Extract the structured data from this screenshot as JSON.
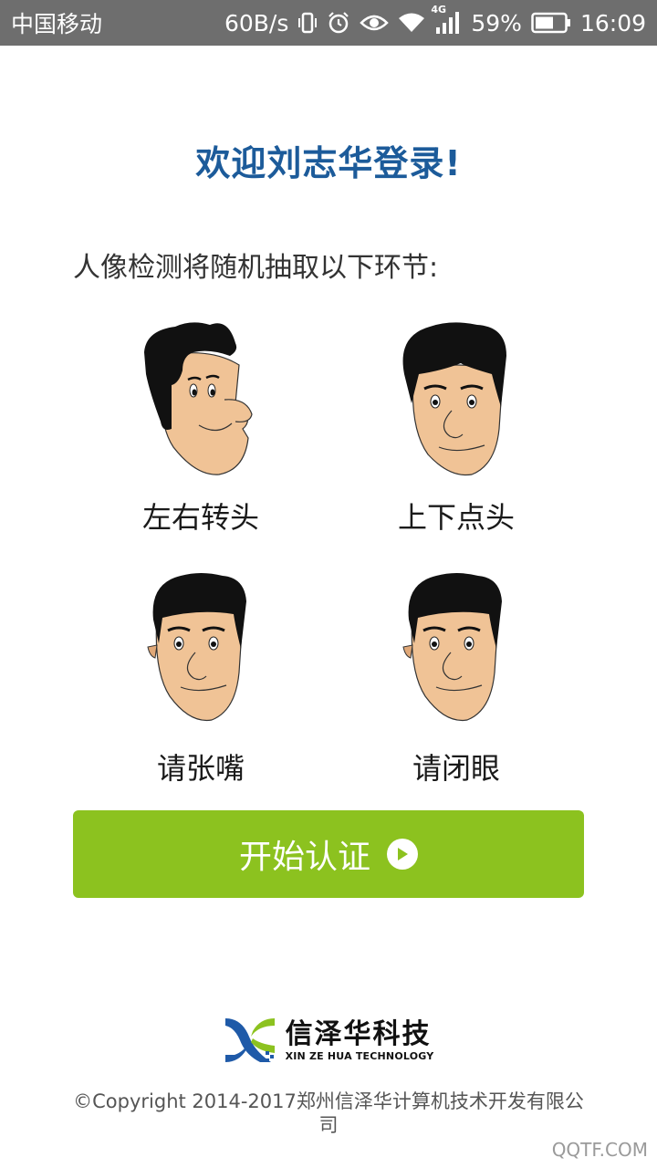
{
  "status_bar": {
    "carrier": "中国移动",
    "speed": "60B/s",
    "network": "4G",
    "battery": "59%",
    "time": "16:09",
    "icons": [
      "vibrate-icon",
      "alarm-icon",
      "eye-icon",
      "wifi-icon",
      "signal-icon",
      "battery-icon"
    ]
  },
  "welcome": "欢迎刘志华登录!",
  "intro": "人像检测将随机抽取以下环节:",
  "faces": [
    {
      "label": "左右转头",
      "icon": "face-turn-head-icon"
    },
    {
      "label": "上下点头",
      "icon": "face-nod-head-icon"
    },
    {
      "label": "请张嘴",
      "icon": "face-open-mouth-icon"
    },
    {
      "label": "请闭眼",
      "icon": "face-close-eyes-icon"
    }
  ],
  "start_button": {
    "label": "开始认证",
    "icon": "play-icon"
  },
  "brand": {
    "cn": "信泽华科技",
    "en": "XIN ZE HUA TECHNOLOGY"
  },
  "copyright": "©Copyright 2014-2017郑州信泽华计算机技术开发有限公司",
  "watermark": "QQTF.COM",
  "colors": {
    "status_bar_bg": "#6e6e6e",
    "welcome_text": "#1c5b9a",
    "button_bg": "#8cc21f",
    "skin": "#f0c396",
    "brand_blue": "#1f5aa8",
    "brand_green": "#8cc21f"
  }
}
